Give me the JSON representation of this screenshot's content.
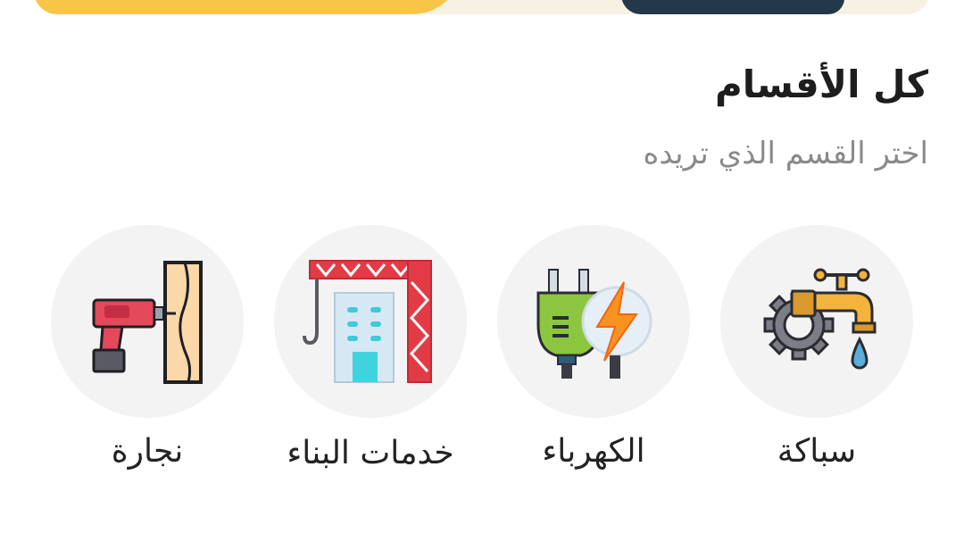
{
  "section": {
    "title": "كل الأقسام",
    "subtitle": "اختر القسم الذي تريده"
  },
  "categories": [
    {
      "label": "سباكة",
      "icon": "plumbing-icon"
    },
    {
      "label": "الكهرباء",
      "icon": "electricity-icon"
    },
    {
      "label": "خدمات البناء",
      "icon": "construction-crane-icon"
    },
    {
      "label": "نجارة",
      "icon": "carpentry-drill-icon"
    }
  ],
  "colors": {
    "banner_yellow": "#f9c548",
    "banner_cream": "#f7f1e3",
    "banner_dark": "#23394a",
    "circle_bg": "#f3f3f3",
    "title": "#1d1d1d",
    "subtitle": "#8a8a8a"
  }
}
